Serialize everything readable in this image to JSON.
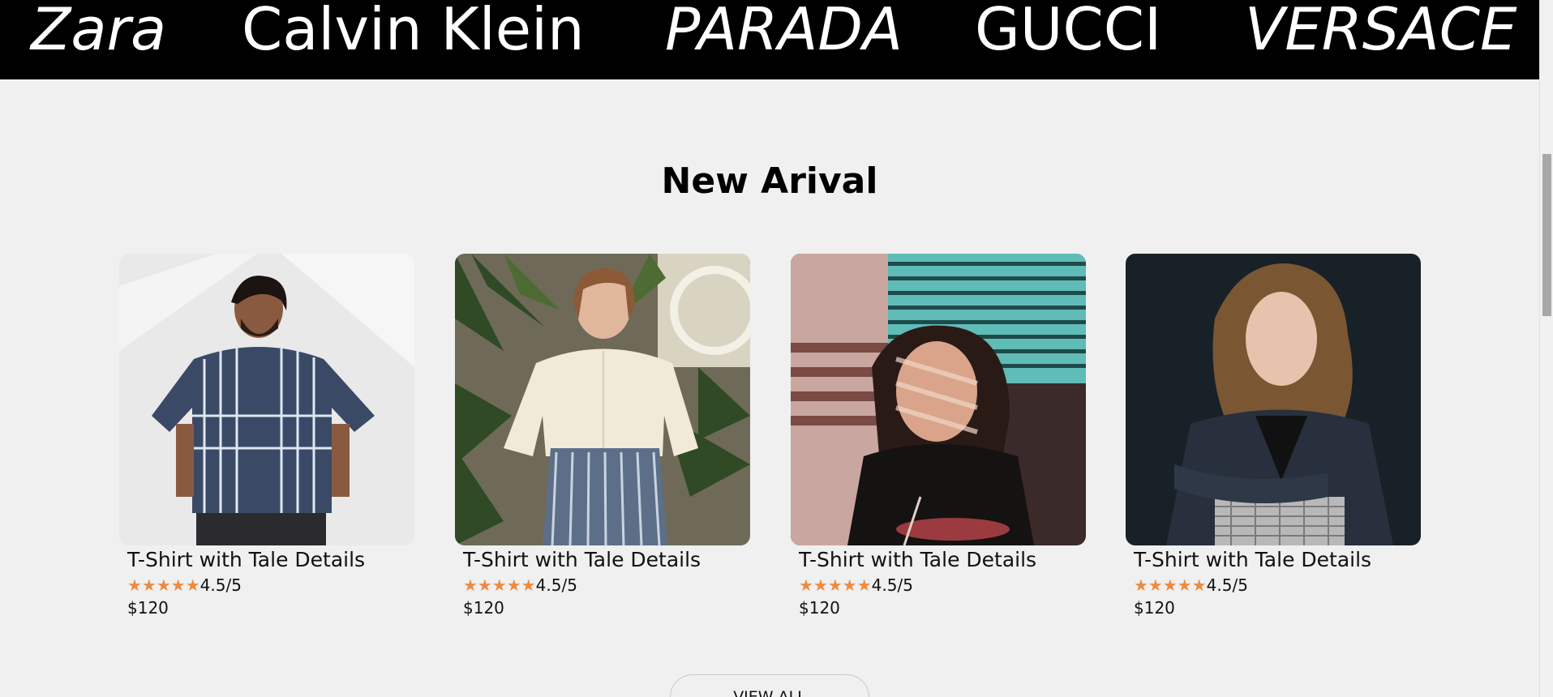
{
  "brands": [
    {
      "label": "Zara",
      "italic": true
    },
    {
      "label": "Calvin Klein",
      "italic": false
    },
    {
      "label": "PARADA",
      "italic": true
    },
    {
      "label": "GUCCI",
      "italic": false
    },
    {
      "label": "VERSACE",
      "italic": true
    }
  ],
  "section": {
    "title": "New Arival"
  },
  "products": [
    {
      "name": "T-Shirt with Tale Details",
      "stars": "★★★★★",
      "rating": "4.5/5",
      "price": "$120",
      "image": "man-striped-shirt-photo"
    },
    {
      "name": "T-Shirt with Tale Details",
      "stars": "★★★★★",
      "rating": "4.5/5",
      "price": "$120",
      "image": "woman-white-blouse-photo"
    },
    {
      "name": "T-Shirt with Tale Details",
      "stars": "★★★★★",
      "rating": "4.5/5",
      "price": "$120",
      "image": "woman-window-blinds-photo"
    },
    {
      "name": "T-Shirt with Tale Details",
      "stars": "★★★★★",
      "rating": "4.5/5",
      "price": "$120",
      "image": "woman-dark-cardigan-photo"
    }
  ],
  "view_all_label": "VIEW ALL",
  "colors": {
    "banner": "#000000",
    "background": "#f0f0f0",
    "star": "#f08a3c"
  }
}
